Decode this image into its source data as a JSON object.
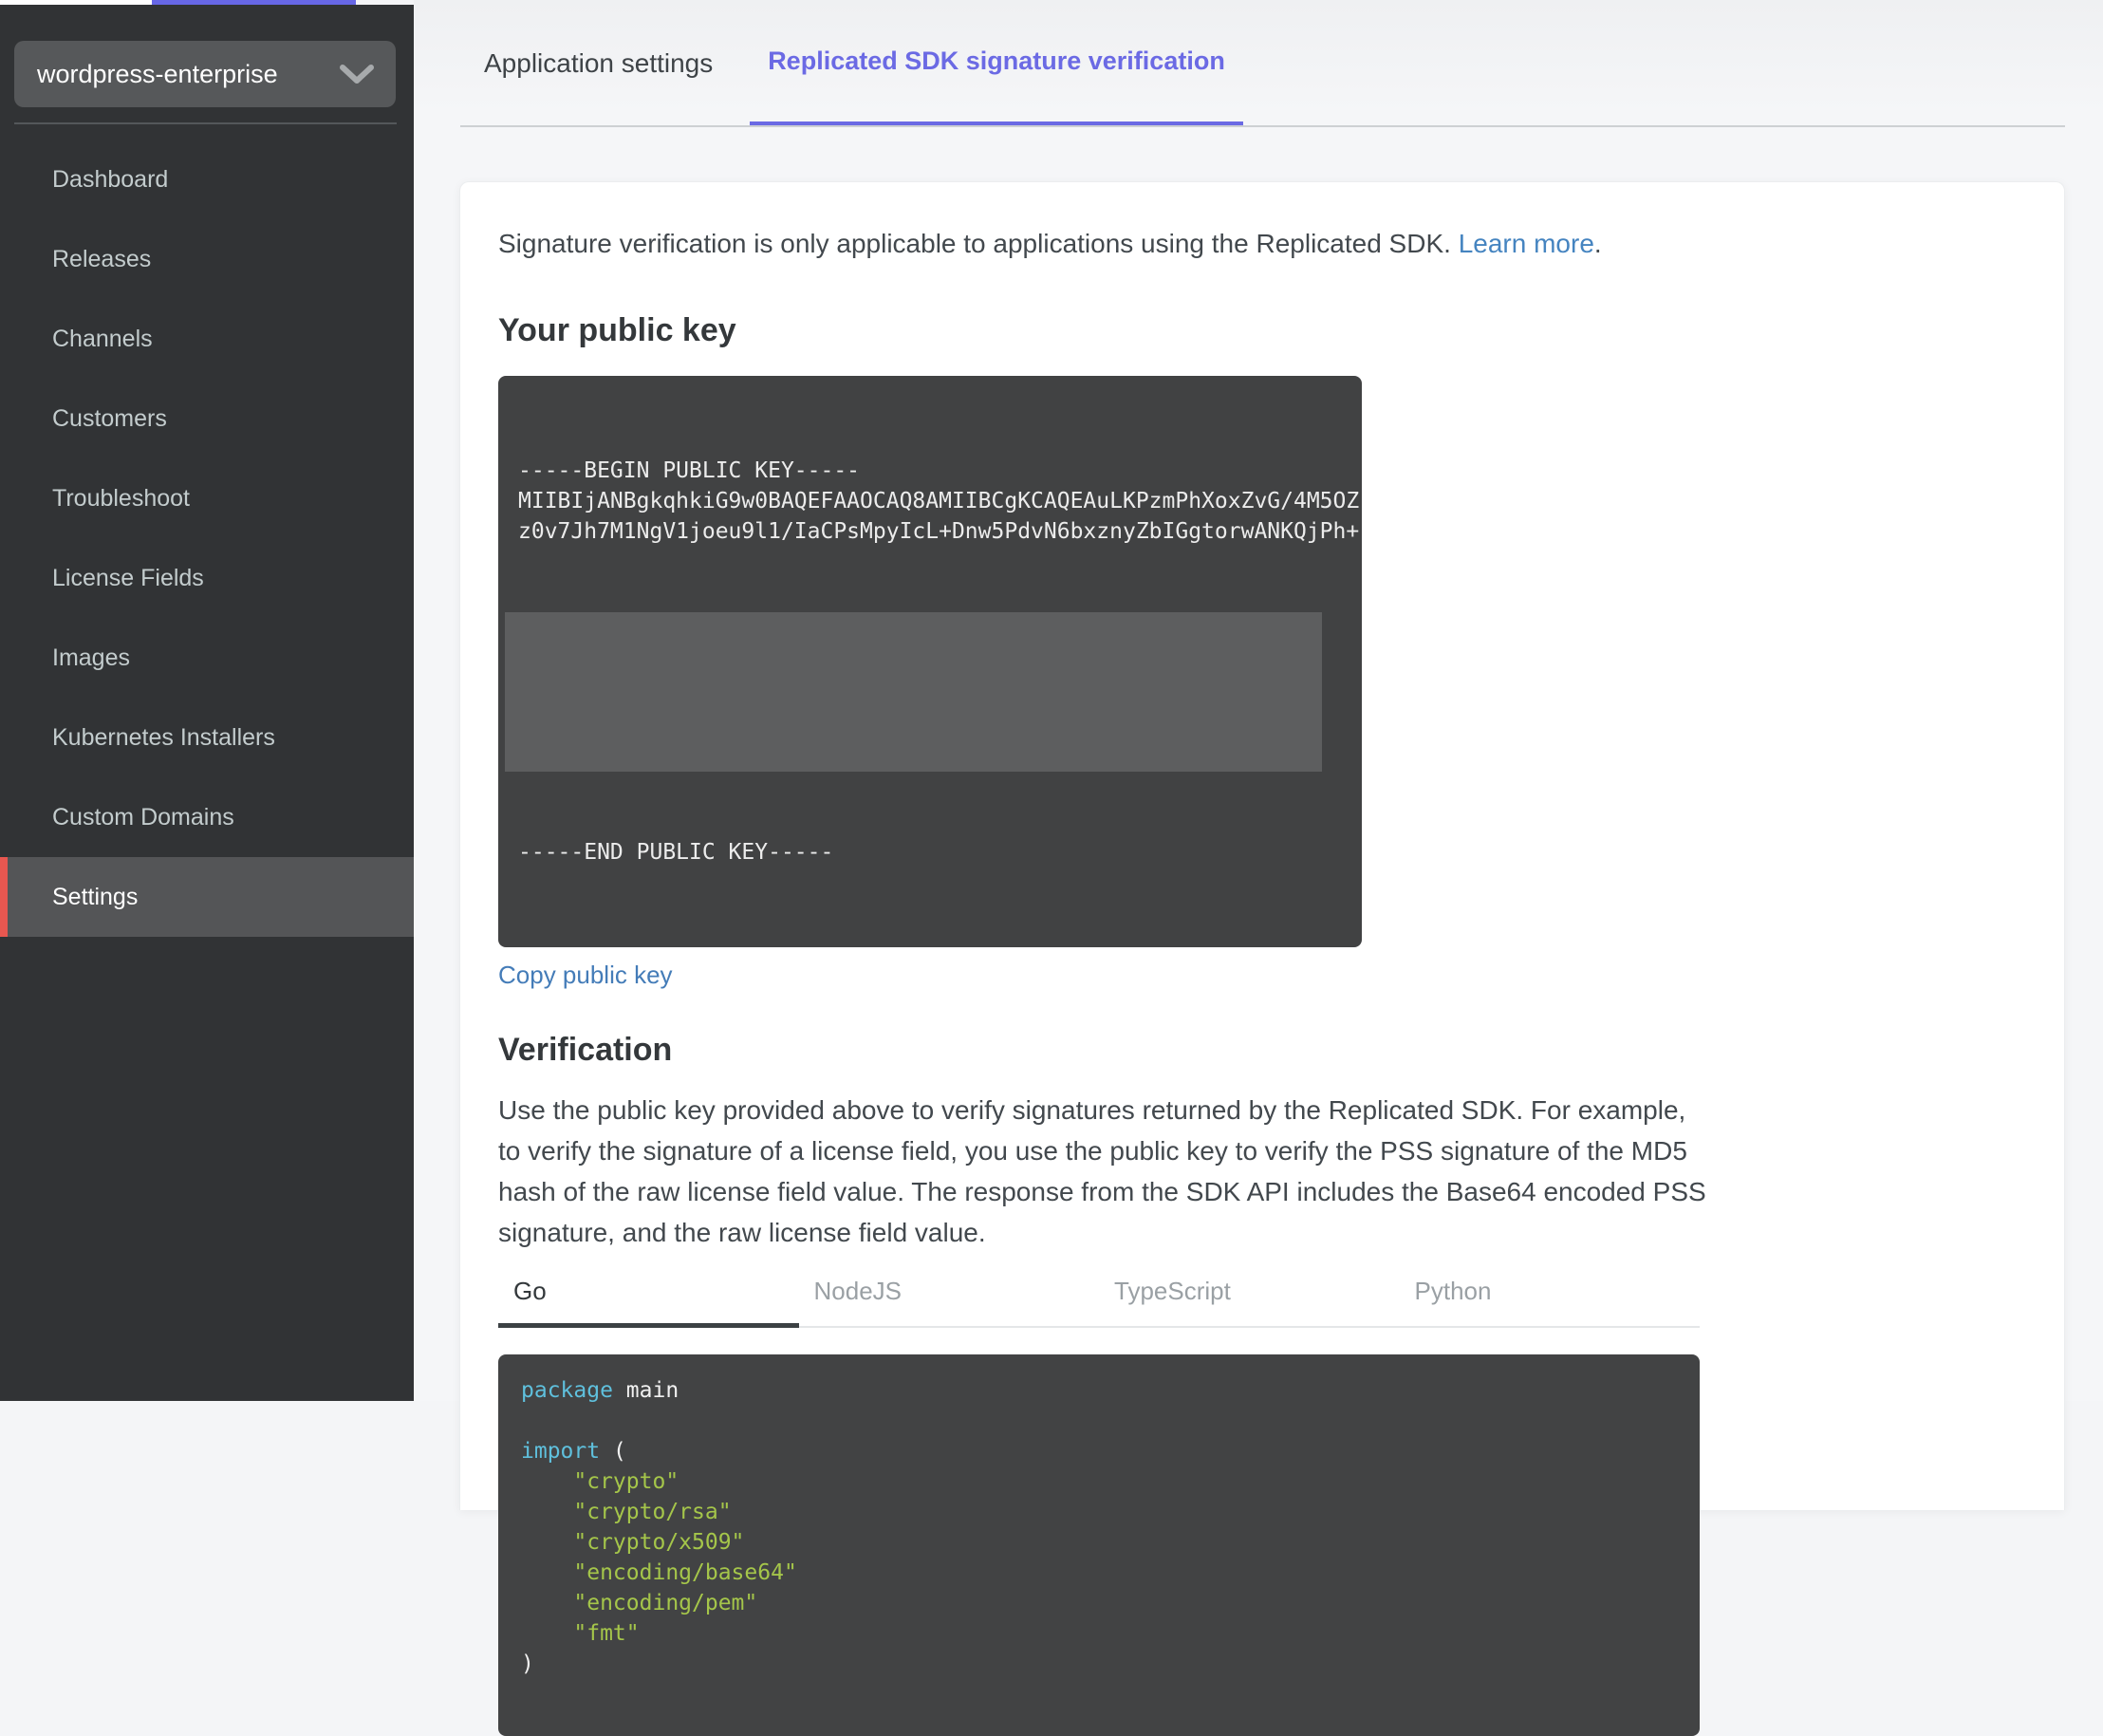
{
  "top_bar": {
    "accent_color": "#6767e6"
  },
  "sidebar": {
    "app_selector": {
      "label": "wordpress-enterprise",
      "chevron_icon": "chevron-down-icon"
    },
    "items": [
      {
        "label": "Dashboard",
        "active": false
      },
      {
        "label": "Releases",
        "active": false
      },
      {
        "label": "Channels",
        "active": false
      },
      {
        "label": "Customers",
        "active": false
      },
      {
        "label": "Troubleshoot",
        "active": false
      },
      {
        "label": "License Fields",
        "active": false
      },
      {
        "label": "Images",
        "active": false
      },
      {
        "label": "Kubernetes Installers",
        "active": false
      },
      {
        "label": "Custom Domains",
        "active": false
      },
      {
        "label": "Settings",
        "active": true
      }
    ],
    "active_item_accent": "#e85750"
  },
  "tabs": [
    {
      "label": "Application settings",
      "active": false
    },
    {
      "label": "Replicated SDK signature verification",
      "active": true
    }
  ],
  "tab_accent_color": "#6b6ae4",
  "content": {
    "intro": {
      "text": "Signature verification is only applicable to applications using the Replicated SDK. ",
      "link_label": "Learn more",
      "suffix": "."
    },
    "public_key": {
      "heading": "Your public key",
      "key_lines_visible": [
        "-----BEGIN PUBLIC KEY-----",
        "MIIBIjANBgkqhkiG9w0BAQEFAAOCAQ8AMIIBCgKCAQEAuLKPzmPhXoxZvG/4M5OZ",
        "z0v7Jh7M1NgV1joeu9l1/IaCPsMpyIcL+Dnw5PdvN6bxznyZbIGgtorwANKQjPh+"
      ],
      "key_line_end": "-----END PUBLIC KEY-----",
      "copy_link_label": "Copy public key"
    },
    "verification": {
      "heading": "Verification",
      "description": "Use the public key provided above to verify signatures returned by the Replicated SDK. For example, to verify the signature of a license field, you use the public key to verify the PSS signature of the MD5 hash of the raw license field value. The response from the SDK API includes the Base64 encoded PSS signature, and the raw license field value.",
      "language_tabs": [
        {
          "label": "Go",
          "active": true
        },
        {
          "label": "NodeJS",
          "active": false
        },
        {
          "label": "TypeScript",
          "active": false
        },
        {
          "label": "Python",
          "active": false
        }
      ],
      "code_lines": [
        [
          {
            "t": "package ",
            "c": "kw"
          },
          {
            "t": "main",
            "c": "pl"
          }
        ],
        [],
        [
          {
            "t": "import ",
            "c": "kw"
          },
          {
            "t": "(",
            "c": "pl"
          }
        ],
        [
          {
            "t": "    \"crypto\"",
            "c": "str"
          }
        ],
        [
          {
            "t": "    \"crypto/rsa\"",
            "c": "str"
          }
        ],
        [
          {
            "t": "    \"crypto/x509\"",
            "c": "str"
          }
        ],
        [
          {
            "t": "    \"encoding/base64\"",
            "c": "str"
          }
        ],
        [
          {
            "t": "    \"encoding/pem\"",
            "c": "str"
          }
        ],
        [
          {
            "t": "    \"fmt\"",
            "c": "str"
          }
        ],
        [
          {
            "t": ")",
            "c": "pl"
          }
        ]
      ]
    }
  },
  "colors": {
    "sidebar_bg": "#313335",
    "sidebar_active_bg": "#545557",
    "sidebar_active_accent": "#e85750",
    "tab_active": "#6b6ae4",
    "link_blue": "#4584c0",
    "copy_link_blue": "#447cb8",
    "code_bg": "#424344",
    "code_keyword": "#5fc0dd",
    "code_string": "#a5c64a",
    "redacted_overlay": "#5d5e5f"
  }
}
